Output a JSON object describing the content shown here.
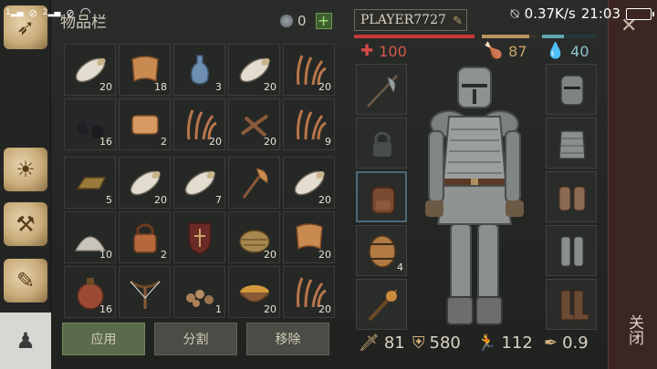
{
  "status_bar": {
    "sim1": "1",
    "sim2": "2",
    "net_speed": "0.37K/s",
    "time": "21:03"
  },
  "inventory": {
    "title": "物品栏",
    "coins": "0",
    "slots_top": [
      {
        "name": "birch-log",
        "qty": "20"
      },
      {
        "name": "leather-hide",
        "qty": "18"
      },
      {
        "name": "glass-bottle",
        "qty": "3"
      },
      {
        "name": "birch-log",
        "qty": "20"
      },
      {
        "name": "dry-grass",
        "qty": "20"
      },
      {
        "name": "coal",
        "qty": "16"
      },
      {
        "name": "leather",
        "qty": "2"
      },
      {
        "name": "dry-grass",
        "qty": "20"
      },
      {
        "name": "sticks",
        "qty": "20"
      },
      {
        "name": "dry-grass",
        "qty": "9"
      }
    ],
    "slots_bottom": [
      {
        "name": "iron-ingot",
        "qty": "5"
      },
      {
        "name": "birch-log",
        "qty": "20"
      },
      {
        "name": "birch-log",
        "qty": "7"
      },
      {
        "name": "axe",
        "qty": ""
      },
      {
        "name": "birch-log",
        "qty": "20"
      },
      {
        "name": "limestone-powder",
        "qty": "10"
      },
      {
        "name": "padlock",
        "qty": "2"
      },
      {
        "name": "shield",
        "qty": ""
      },
      {
        "name": "basket",
        "qty": "20"
      },
      {
        "name": "leather-hide",
        "qty": "20"
      },
      {
        "name": "flask",
        "qty": "16"
      },
      {
        "name": "crossbow",
        "qty": ""
      },
      {
        "name": "stones",
        "qty": "1"
      },
      {
        "name": "stew-bowl",
        "qty": "20"
      },
      {
        "name": "dry-grass",
        "qty": "20"
      }
    ],
    "actions": {
      "apply": "应用",
      "split": "分割",
      "remove": "移除"
    }
  },
  "character": {
    "player_name": "PLAYER7727",
    "health": "100",
    "food": "87",
    "water": "40",
    "weapon_slots": [
      {
        "name": "halberd",
        "qty": ""
      },
      {
        "name": "locked",
        "qty": ""
      },
      {
        "name": "backpack",
        "qty": ""
      },
      {
        "name": "barrel",
        "qty": "4"
      },
      {
        "name": "torch",
        "qty": ""
      }
    ],
    "armor_slots": [
      {
        "name": "great-helm"
      },
      {
        "name": "chest-armor"
      },
      {
        "name": "gauntlets"
      },
      {
        "name": "leg-armor"
      },
      {
        "name": "boots"
      }
    ],
    "stats": {
      "attack": "81",
      "defense": "580",
      "speed": "112",
      "weight": "0.9"
    }
  },
  "close_label": "关闭",
  "colors": {
    "health": "#c73a3a",
    "food": "#b99560",
    "water": "#5ea7b0",
    "accent": "#5a6a4a"
  }
}
